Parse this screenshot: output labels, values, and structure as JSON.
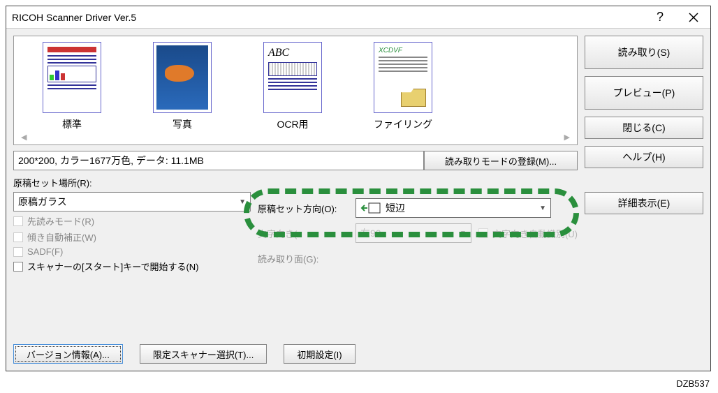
{
  "window": {
    "title": "RICOH Scanner Driver Ver.5"
  },
  "modes": {
    "items": [
      {
        "label": "標準"
      },
      {
        "label": "写真"
      },
      {
        "label": "OCR用"
      },
      {
        "label": "ファイリング"
      }
    ]
  },
  "status": {
    "info": "200*200, カラー1677万色, データ: 11.1MB",
    "register_btn": "読み取りモードの登録(M)..."
  },
  "form": {
    "location_label": "原稿セット場所(R):",
    "location_value": "原稿ガラス",
    "preread_label": "先読みモード(R)",
    "deskew_label": "傾き自動補正(W)",
    "sadf_label": "SADF(F)",
    "start_key_label": "スキャナーの[スタート]キーで開始する(N)",
    "orient_label": "原稿セット方向(O):",
    "orient_value": "短辺",
    "text_dir_label": "文字向き(",
    "text_dir_value": "左90",
    "auto_detect_label": "文字向き自動識別(U)",
    "side_label": "読み取り面(G):"
  },
  "buttons": {
    "scan": "読み取り(S)",
    "preview": "プレビュー(P)",
    "close": "閉じる(C)",
    "help": "ヘルプ(H)",
    "details": "詳細表示(E)",
    "version": "バージョン情報(A)...",
    "limited": "限定スキャナー選択(T)...",
    "defaults": "初期設定(I)"
  },
  "figure_id": "DZB537"
}
